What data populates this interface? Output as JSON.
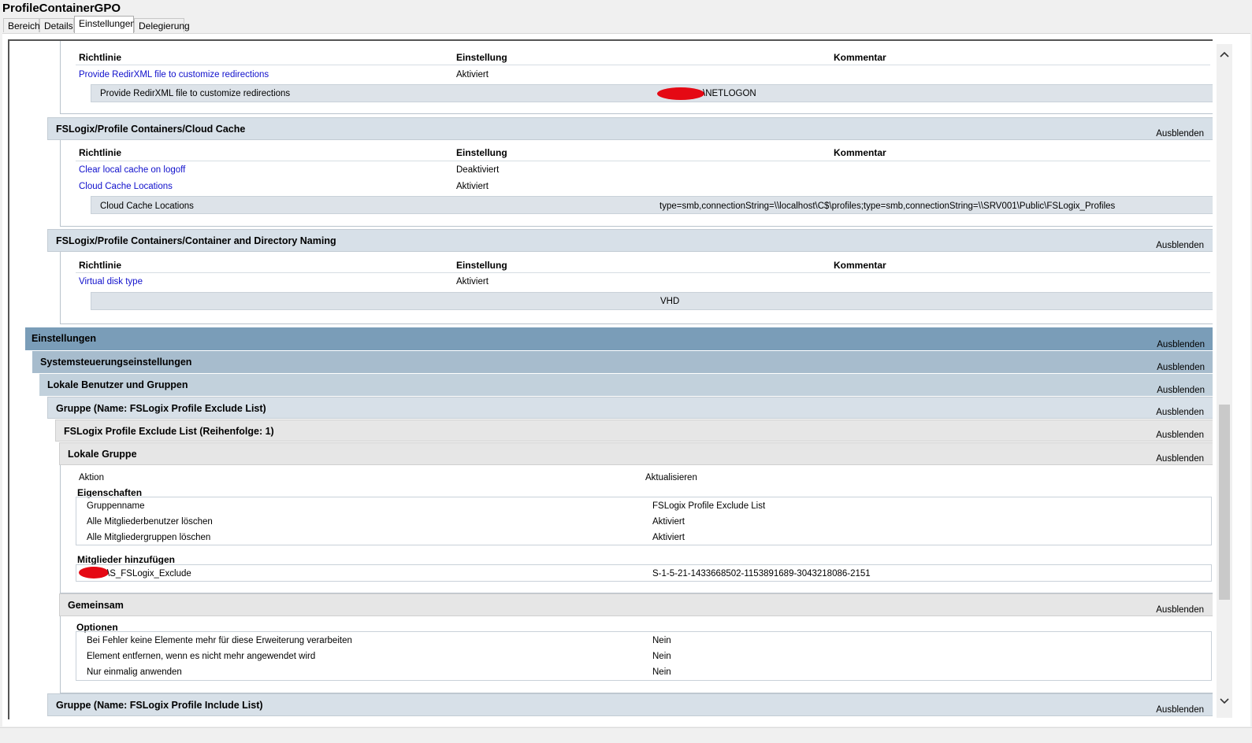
{
  "window": {
    "title": "ProfileContainerGPO"
  },
  "tabs": [
    "Bereich",
    "Details",
    "Einstellungen",
    "Delegierung"
  ],
  "active_tab": "Einstellungen",
  "common": {
    "hide": "Ausblenden",
    "col_policy": "Richtlinie",
    "col_setting": "Einstellung",
    "col_comment": "Kommentar"
  },
  "redir": {
    "policy": "Provide RedirXML file to customize redirections",
    "state": "Aktiviert",
    "sub_label": "Provide RedirXML file to customize redirections",
    "sub_value": "\\NETLOGON"
  },
  "cloud_cache": {
    "header": "FSLogix/Profile Containers/Cloud Cache",
    "rows": [
      {
        "policy": "Clear local cache on logoff",
        "state": "Deaktiviert"
      },
      {
        "policy": "Cloud Cache Locations",
        "state": "Aktiviert"
      }
    ],
    "sub_label": "Cloud Cache Locations",
    "sub_value": "type=smb,connectionString=\\\\localhost\\C$\\profiles;type=smb,connectionString=\\\\SRV001\\Public\\FSLogix_Profiles"
  },
  "naming": {
    "header": "FSLogix/Profile Containers/Container and Directory Naming",
    "policy": "Virtual disk type",
    "state": "Aktiviert",
    "sub_value": "VHD"
  },
  "prefs": {
    "einstellungen": "Einstellungen",
    "systemsteuerung": "Systemsteuerungseinstellungen",
    "lokale_benutzer": "Lokale Benutzer und Gruppen",
    "gruppe_exclude": "Gruppe (Name: FSLogix Profile Exclude List)",
    "exclude_order": "FSLogix Profile Exclude List (Reihenfolge: 1)",
    "lokale_gruppe": "Lokale Gruppe",
    "aktion_label": "Aktion",
    "aktion_value": "Aktualisieren",
    "eigenschaften": "Eigenschaften",
    "props": [
      {
        "label": "Gruppenname",
        "value": "FSLogix Profile Exclude List"
      },
      {
        "label": "Alle Mitgliederbenutzer löschen",
        "value": "Aktiviert"
      },
      {
        "label": "Alle Mitgliedergruppen löschen",
        "value": "Aktiviert"
      }
    ],
    "mitglieder": "Mitglieder hinzufügen",
    "member_name": "\\S_FSLogix_Exclude",
    "member_sid": "S-1-5-21-1433668502-1153891689-3043218086-2151",
    "gemeinsam": "Gemeinsam",
    "optionen": "Optionen",
    "options": [
      {
        "label": "Bei Fehler keine Elemente mehr für diese Erweiterung verarbeiten",
        "value": "Nein"
      },
      {
        "label": "Element entfernen, wenn es nicht mehr angewendet wird",
        "value": "Nein"
      },
      {
        "label": "Nur einmalig anwenden",
        "value": "Nein"
      }
    ],
    "gruppe_include": "Gruppe (Name: FSLogix Profile Include List)"
  },
  "colors": {
    "header_dark": "#7a9db8",
    "header_mid": "#a7bccd",
    "header_light": "#d7e0e8",
    "header_gray": "#e6e6e6",
    "link": "#1010cc",
    "redaction": "#e50914"
  },
  "icons": {
    "scroll_up": "chevron-up-icon",
    "scroll_down": "chevron-down-icon"
  }
}
